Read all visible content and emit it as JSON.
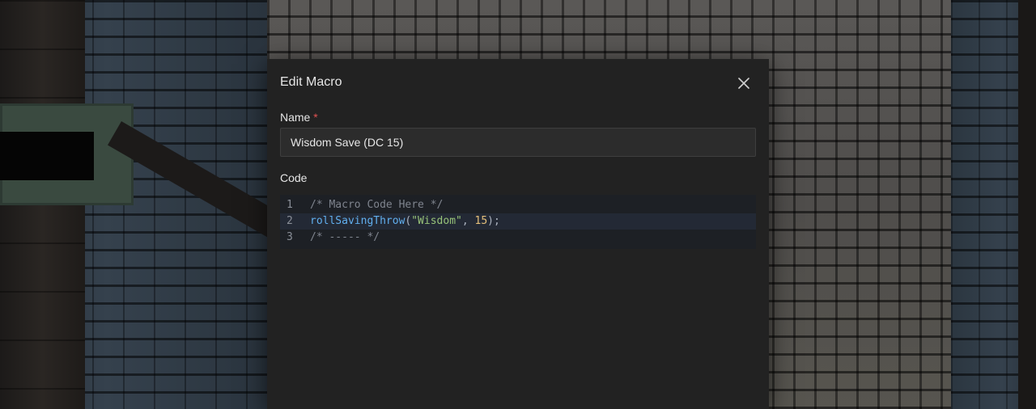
{
  "modal": {
    "title": "Edit Macro",
    "close_icon": "close-icon",
    "name_label": "Name",
    "required_mark": "*",
    "name_value": "Wisdom Save (DC 15)",
    "code_label": "Code"
  },
  "code_editor": {
    "active_line": 2,
    "lines": [
      {
        "number": "1",
        "tokens": [
          {
            "type": "comment",
            "text": "/* Macro Code Here */"
          }
        ]
      },
      {
        "number": "2",
        "tokens": [
          {
            "type": "fn",
            "text": "rollSavingThrow"
          },
          {
            "type": "punc",
            "text": "("
          },
          {
            "type": "str",
            "text": "\"Wisdom\""
          },
          {
            "type": "punc",
            "text": ", "
          },
          {
            "type": "num",
            "text": "15"
          },
          {
            "type": "punc",
            "text": ");"
          }
        ]
      },
      {
        "number": "3",
        "tokens": [
          {
            "type": "comment",
            "text": "/* ----- */"
          }
        ]
      }
    ]
  },
  "colors": {
    "modal_bg": "#222222",
    "required": "#e05252",
    "comment": "#7f848e",
    "function": "#61afef",
    "string": "#98c379",
    "number": "#e5c07b"
  }
}
